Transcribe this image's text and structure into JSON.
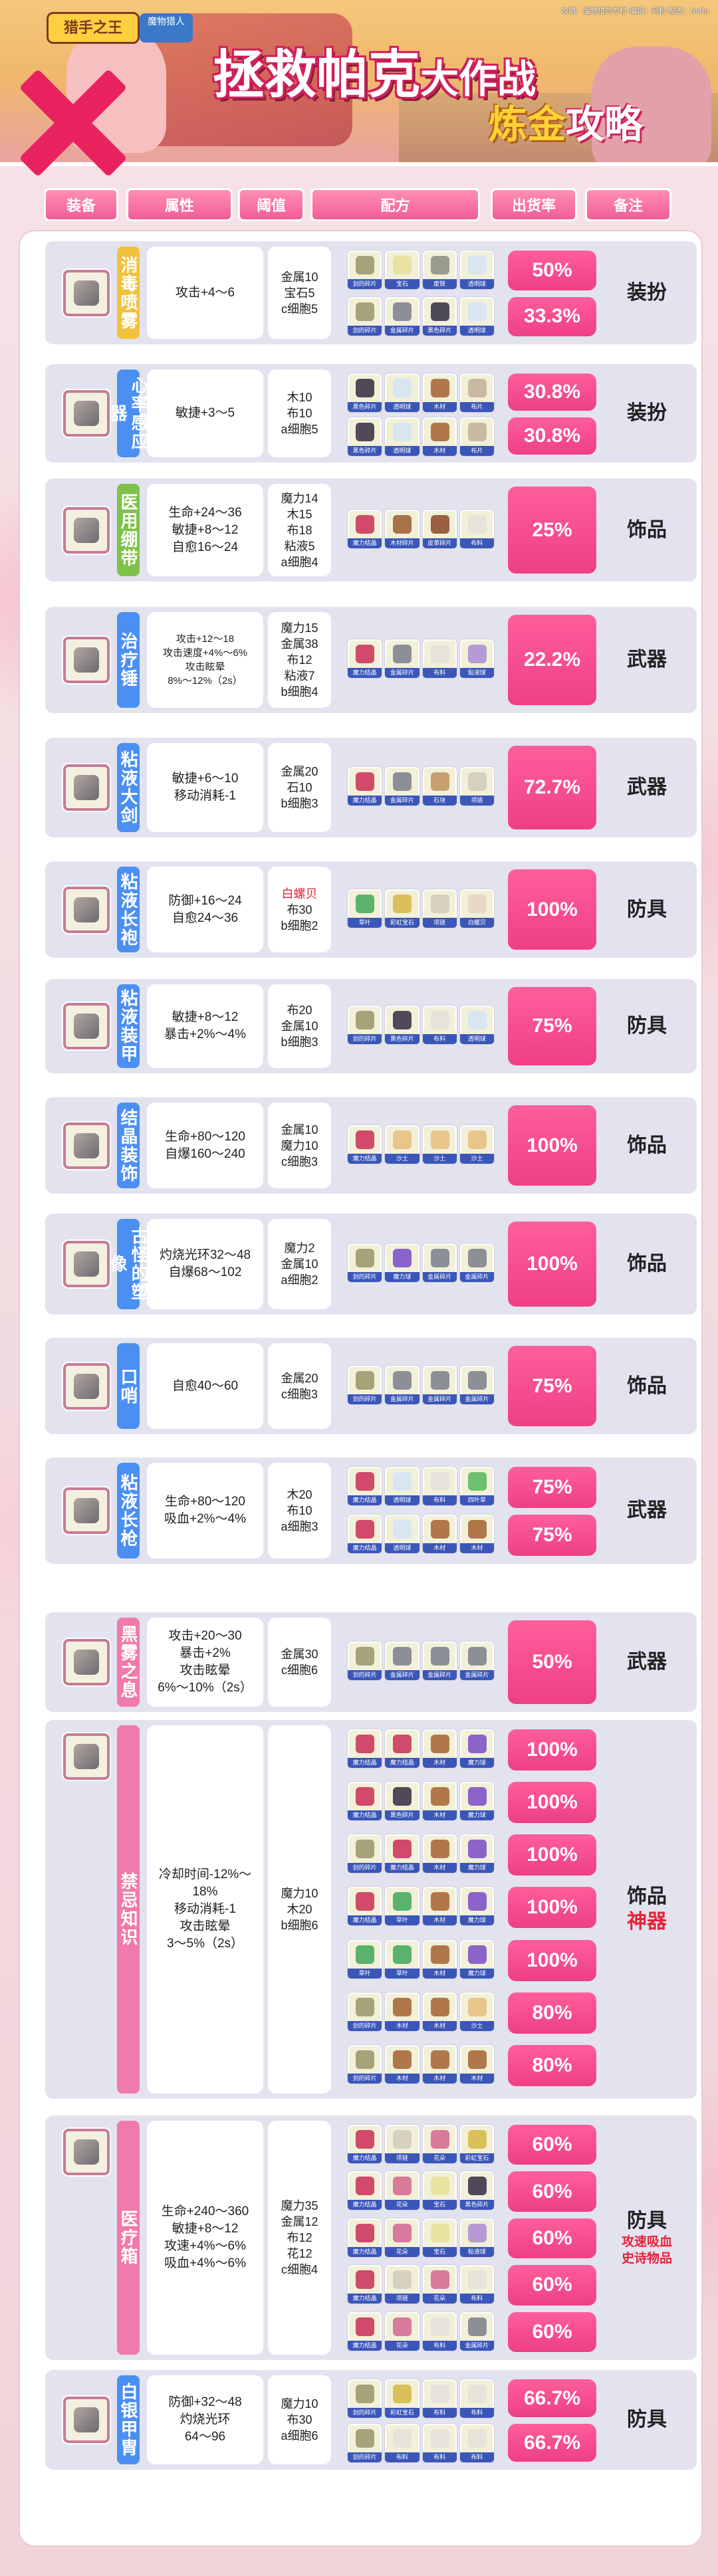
{
  "banner": {
    "logo": "猎手之王",
    "logo2": "魔物猎人",
    "credit": "攻略：魔物猎的专栏·编辑：阿松·制表：Nolilu",
    "title_main": "拯救帕克",
    "title_sub": "大作战",
    "subtitle_a": "炼金",
    "subtitle_b": "攻略"
  },
  "headers": {
    "equip": "装备",
    "attr": "属性",
    "threshold": "阈值",
    "recipe": "配方",
    "rate": "出货率",
    "note": "备注"
  },
  "colors": {
    "accent": "#ee3f86",
    "header": "#f25d96",
    "row_bg": "#e2e3ef",
    "ingredient_tag": "#3b56b9",
    "name_yellow": "#f1c23b",
    "name_blue": "#4b8ff2",
    "name_pink": "#f07aa9",
    "name_green": "#7fc24a"
  },
  "items": [
    {
      "name": "消毒喷雾",
      "name_color": "yellow",
      "icon": "spray-icon",
      "attr": [
        "攻击+4～6"
      ],
      "threshold": [
        "金属10",
        "宝石5",
        "c细胞5"
      ],
      "recipes": [
        {
          "ing": [
            "剑的碎片",
            "宝石",
            "废铁",
            "透明球"
          ],
          "rate": "50%"
        },
        {
          "ing": [
            "剑的碎片",
            "金属碎片",
            "黑色碎片",
            "透明球"
          ],
          "rate": "33.3%"
        }
      ],
      "note": [
        "装扮"
      ]
    },
    {
      "name": "心率感应器",
      "name_color": "blue",
      "icon": "heart-monitor-icon",
      "attr": [
        "敏捷+3～5"
      ],
      "threshold": [
        "木10",
        "布10",
        "a细胞5"
      ],
      "recipes": [
        {
          "ing": [
            "黑色碎片",
            "透明球",
            "木材",
            "布片"
          ],
          "rate": "30.8%"
        },
        {
          "ing": [
            "黑色碎片",
            "透明球",
            "木材",
            "布片"
          ],
          "rate": "30.8%"
        }
      ],
      "note": [
        "装扮"
      ]
    },
    {
      "name": "医用绷带",
      "name_color": "green",
      "icon": "bandage-icon",
      "attr": [
        "生命+24～36",
        "敏捷+8～12",
        "自愈16～24"
      ],
      "threshold": [
        "魔力14",
        "木15",
        "布18",
        "粘液5",
        "a细胞4"
      ],
      "recipes": [
        {
          "ing": [
            "魔力结晶",
            "木材碎片",
            "皮革碎片",
            "布料"
          ],
          "rate": "25%"
        }
      ],
      "note": [
        "饰品"
      ]
    },
    {
      "name": "治疗锤",
      "name_color": "blue",
      "icon": "hammer-icon",
      "attr": [
        "攻击+12～18",
        "攻击速度+4%～6%",
        "攻击眩晕",
        "8%～12%（2s）"
      ],
      "attr_small": true,
      "threshold": [
        "魔力15",
        "金属38",
        "布12",
        "粘液7",
        "b细胞4"
      ],
      "recipes": [
        {
          "ing": [
            "魔力结晶",
            "金属碎片",
            "布料",
            "粘液球"
          ],
          "rate": "22.2%"
        }
      ],
      "note": [
        "武器"
      ]
    },
    {
      "name": "粘液大剑",
      "name_color": "blue",
      "icon": "sword-icon",
      "attr": [
        "敏捷+6～10",
        "移动消耗-1"
      ],
      "threshold": [
        "金属20",
        "石10",
        "b细胞3"
      ],
      "recipes": [
        {
          "ing": [
            "魔力结晶",
            "金属碎片",
            "石块",
            "项链"
          ],
          "rate": "72.7%"
        }
      ],
      "note": [
        "武器"
      ]
    },
    {
      "name": "粘液长袍",
      "name_color": "blue",
      "icon": "robe-icon",
      "attr": [
        "防御+16～24",
        "自愈24～36"
      ],
      "threshold": [
        "白螺贝",
        "布30",
        "b细胞2"
      ],
      "recipes": [
        {
          "ing": [
            "草叶",
            "彩虹宝石",
            "项链",
            "白螺贝"
          ],
          "rate": "100%"
        }
      ],
      "note": [
        "防具"
      ]
    },
    {
      "name": "粘液装甲",
      "name_color": "blue",
      "icon": "armor-icon",
      "attr": [
        "敏捷+8～12",
        "暴击+2%～4%"
      ],
      "threshold": [
        "布20",
        "金属10",
        "b细胞3"
      ],
      "recipes": [
        {
          "ing": [
            "剑的碎片",
            "黑色碎片",
            "布料",
            "透明球"
          ],
          "rate": "75%"
        }
      ],
      "note": [
        "防具"
      ]
    },
    {
      "name": "结晶装饰",
      "name_color": "blue",
      "icon": "crystal-orb-icon",
      "attr": [
        "生命+80～120",
        "自爆160～240"
      ],
      "threshold": [
        "金属10",
        "魔力10",
        "c细胞3"
      ],
      "recipes": [
        {
          "ing": [
            "魔力结晶",
            "沙土",
            "沙土",
            "沙土"
          ],
          "rate": "100%"
        }
      ],
      "note": [
        "饰品"
      ]
    },
    {
      "name": "古怪的塑像",
      "name_color": "blue",
      "icon": "statue-icon",
      "attr": [
        "灼烧光环32～48",
        "自爆68～102"
      ],
      "threshold": [
        "魔力2",
        "金属10",
        "a细胞2"
      ],
      "recipes": [
        {
          "ing": [
            "剑的碎片",
            "魔力球",
            "金属碎片",
            "金属碎片"
          ],
          "rate": "100%"
        }
      ],
      "note": [
        "饰品"
      ]
    },
    {
      "name": "口哨",
      "name_color": "blue",
      "icon": "whistle-icon",
      "attr": [
        "自愈40～60"
      ],
      "threshold": [
        "金属20",
        "c细胞3"
      ],
      "recipes": [
        {
          "ing": [
            "剑的碎片",
            "金属碎片",
            "金属碎片",
            "金属碎片"
          ],
          "rate": "75%"
        }
      ],
      "note": [
        "饰品"
      ]
    },
    {
      "name": "粘液长枪",
      "name_color": "blue",
      "icon": "spear-icon",
      "attr": [
        "生命+80～120",
        "吸血+2%～4%"
      ],
      "threshold": [
        "木20",
        "布10",
        "a细胞3"
      ],
      "recipes": [
        {
          "ing": [
            "魔力结晶",
            "透明球",
            "布料",
            "四叶草"
          ],
          "rate": "75%"
        },
        {
          "ing": [
            "魔力结晶",
            "透明球",
            "木材",
            "木材"
          ],
          "rate": "75%"
        }
      ],
      "note": [
        "武器"
      ]
    },
    {
      "name": "黑雾之息",
      "name_color": "pink",
      "icon": "black-mist-icon",
      "attr": [
        "攻击+20～30",
        "暴击+2%",
        "攻击眩晕",
        "6%～10%（2s）"
      ],
      "threshold": [
        "金属30",
        "c细胞6"
      ],
      "recipes": [
        {
          "ing": [
            "剑的碎片",
            "金属碎片",
            "金属碎片",
            "金属碎片"
          ],
          "rate": "50%"
        }
      ],
      "note": [
        "武器"
      ]
    },
    {
      "name": "禁忌知识",
      "name_color": "pink",
      "icon": "forbidden-book-icon",
      "attr": [
        "冷却时间-12%～18%",
        "移动消耗-1",
        "攻击眩晕",
        "3～5%（2s）"
      ],
      "threshold": [
        "魔力10",
        "木20",
        "b细胞6"
      ],
      "recipes": [
        {
          "ing": [
            "魔力结晶",
            "魔力结晶",
            "木材",
            "魔力球"
          ],
          "rate": "100%"
        },
        {
          "ing": [
            "魔力结晶",
            "黑色碎片",
            "木材",
            "魔力球"
          ],
          "rate": "100%"
        },
        {
          "ing": [
            "剑的碎片",
            "魔力结晶",
            "木材",
            "魔力球"
          ],
          "rate": "100%"
        },
        {
          "ing": [
            "魔力结晶",
            "草叶",
            "木材",
            "魔力球"
          ],
          "rate": "100%"
        },
        {
          "ing": [
            "草叶",
            "草叶",
            "木材",
            "魔力球"
          ],
          "rate": "100%"
        },
        {
          "ing": [
            "剑的碎片",
            "木材",
            "木材",
            "沙土"
          ],
          "rate": "80%"
        },
        {
          "ing": [
            "剑的碎片",
            "木材",
            "木材",
            "木材"
          ],
          "rate": "80%"
        }
      ],
      "note": [
        "饰品",
        "神器"
      ]
    },
    {
      "name": "医疗箱",
      "name_color": "pink",
      "icon": "medkit-icon",
      "attr": [
        "生命+240～360",
        "敏捷+8～12",
        "攻速+4%～6%",
        "吸血+4%～6%"
      ],
      "threshold": [
        "魔力35",
        "金属12",
        "布12",
        "花12",
        "c细胞4"
      ],
      "recipes": [
        {
          "ing": [
            "魔力结晶",
            "项链",
            "花朵",
            "彩虹宝石"
          ],
          "rate": "60%"
        },
        {
          "ing": [
            "魔力结晶",
            "花朵",
            "宝石",
            "黑色碎片"
          ],
          "rate": "60%"
        },
        {
          "ing": [
            "魔力结晶",
            "花朵",
            "宝石",
            "粘液球"
          ],
          "rate": "60%"
        },
        {
          "ing": [
            "魔力结晶",
            "项链",
            "花朵",
            "布料"
          ],
          "rate": "60%"
        },
        {
          "ing": [
            "魔力结晶",
            "花朵",
            "布料",
            "金属碎片"
          ],
          "rate": "60%"
        }
      ],
      "note": [
        "防具",
        "攻速吸血",
        "史诗物品"
      ]
    },
    {
      "name": "白银甲胄",
      "name_color": "blue",
      "icon": "silver-armor-icon",
      "attr": [
        "防御+32～48",
        "灼烧光环",
        "64～96"
      ],
      "threshold": [
        "魔力10",
        "布30",
        "a细胞6"
      ],
      "recipes": [
        {
          "ing": [
            "剑的碎片",
            "彩虹宝石",
            "布料",
            "布料"
          ],
          "rate": "66.7%"
        },
        {
          "ing": [
            "剑的碎片",
            "布料",
            "布料",
            "布料"
          ],
          "rate": "66.7%"
        }
      ],
      "note": [
        "防具"
      ]
    }
  ]
}
